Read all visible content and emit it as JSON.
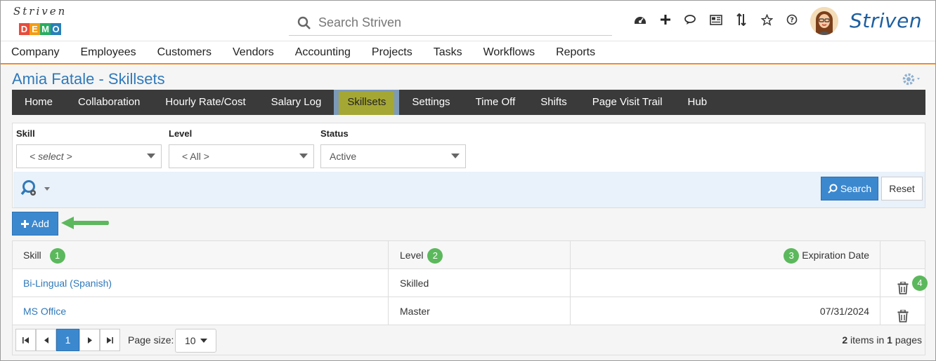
{
  "header": {
    "logo_script": "Striven",
    "logo_demo": [
      "D",
      "E",
      "M",
      "O"
    ],
    "logo_demo_colors": [
      "#e74c3c",
      "#f39c12",
      "#27ae60",
      "#2980b9"
    ],
    "search_placeholder": "Search Striven",
    "icons": [
      "dashboard-icon",
      "plus-icon",
      "chat-icon",
      "news-icon",
      "sort-icon",
      "star-icon",
      "help-icon"
    ],
    "brand": "Striven"
  },
  "top_nav": [
    "Company",
    "Employees",
    "Customers",
    "Vendors",
    "Accounting",
    "Projects",
    "Tasks",
    "Workflows",
    "Reports"
  ],
  "page": {
    "title": "Amia Fatale - Skillsets"
  },
  "tabs": [
    "Home",
    "Collaboration",
    "Hourly Rate/Cost",
    "Salary Log",
    "Skillsets",
    "Settings",
    "Time Off",
    "Shifts",
    "Page Visit Trail",
    "Hub"
  ],
  "active_tab": "Skillsets",
  "filters": {
    "skill_label": "Skill",
    "skill_value": "< select >",
    "level_label": "Level",
    "level_value": "< All >",
    "status_label": "Status",
    "status_value": "Active",
    "search_button": "Search",
    "reset_button": "Reset"
  },
  "add_button": "Add",
  "grid": {
    "columns": [
      "Skill",
      "Level",
      "Expiration Date"
    ],
    "badges": [
      "1",
      "2",
      "3",
      "4"
    ],
    "rows": [
      {
        "skill": "Bi-Lingual (Spanish)",
        "level": "Skilled",
        "expiration": ""
      },
      {
        "skill": "MS Office",
        "level": "Master",
        "expiration": "07/31/2024"
      }
    ]
  },
  "pager": {
    "current_page": "1",
    "page_size_label": "Page size:",
    "page_size": "10",
    "items_count": "2",
    "items_label": " items in ",
    "pages_count": "1",
    "pages_label": " pages"
  },
  "colors": {
    "accent": "#3b88cf",
    "title": "#2f79b9",
    "active_tab": "#a5a734",
    "nav_underline": "#f08a24",
    "annotation": "#5cb85c"
  }
}
